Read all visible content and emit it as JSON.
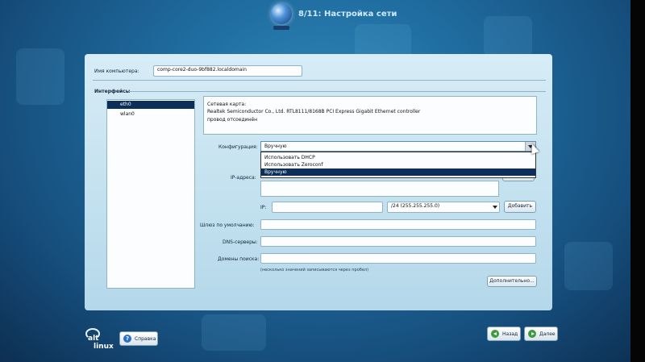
{
  "window": {
    "title": "8/11: Настройка сети"
  },
  "computer_name": {
    "label": "Имя компьютера:",
    "value": "comp-core2-duo-9bf882.localdomain"
  },
  "interfaces": {
    "heading": "Интерфейсы",
    "items": [
      {
        "label": "eth0",
        "selected": true
      },
      {
        "label": "wlan0",
        "selected": false
      }
    ]
  },
  "card_info": {
    "line1": "Сетевая карта:",
    "line2": "Realtek Semiconductor Co., Ltd. RTL8111/8168B PCI Express Gigabit Ethernet controller",
    "line3": "провод отсоединён"
  },
  "configuration": {
    "label": "Конфигурация:",
    "value": "Вручную",
    "options": [
      "Использовать DHCP",
      "Использовать Zeroconf",
      "Вручную"
    ]
  },
  "ip_section": {
    "addresses_label": "IP-адреса:",
    "ip_label": "IP:",
    "ip_value": "",
    "mask_value": "/24 (255.255.255.0)",
    "add_button": "Добавить"
  },
  "gateway": {
    "label": "Шлюз по умолчанию:",
    "value": ""
  },
  "dns": {
    "label": "DNS-серверы:",
    "value": ""
  },
  "search_domains": {
    "label": "Домены поиска:",
    "value": ""
  },
  "hint": "(несколько значений записываются через пробел)",
  "advanced_button": "Дополнительно...",
  "footer": {
    "logo_top": "alt",
    "logo_bottom": "linux",
    "help_button": "Справка",
    "back_button": "Назад",
    "next_button": "Далее"
  },
  "colors": {
    "background": "#1f6c9f",
    "panel": "#c6e2f0",
    "selection": "#0b2f5a"
  }
}
